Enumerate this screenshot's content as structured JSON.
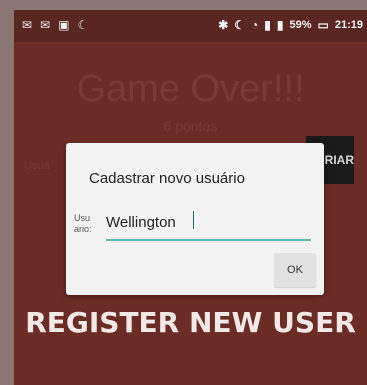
{
  "status_bar": {
    "battery": "59%",
    "time": "21:19"
  },
  "game": {
    "title": "Game Over!!!",
    "subtitle": "6 pontos",
    "user_label_bg": "Usuá",
    "bg_button_label": "RIAR"
  },
  "dialog": {
    "title": "Cadastrar novo usuário",
    "field_label": "Usu ario:",
    "field_value": "Wellington",
    "ok_label": "OK"
  },
  "caption": "REGISTER NEW USER",
  "icons": {
    "status_left": [
      "message-icon",
      "email-icon",
      "image-icon",
      "moon-icon"
    ],
    "status_right": [
      "bluetooth-icon",
      "moon-icon",
      "wifi-icon",
      "signal-icon",
      "signal-icon-2",
      "battery-icon"
    ]
  },
  "colors": {
    "background": "#6c2c26",
    "dialog": "#f3f3f3",
    "accent": "#6ab7b2",
    "caption": "#f2e9e7"
  }
}
